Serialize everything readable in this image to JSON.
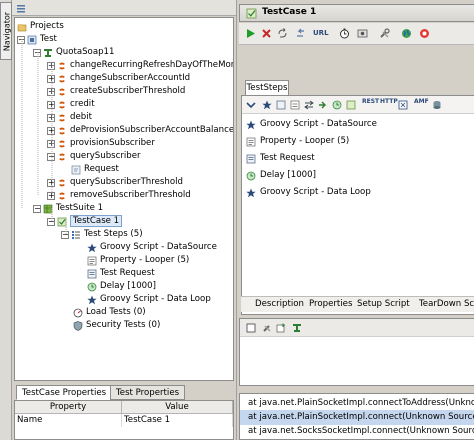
{
  "navigator": {
    "label": "Navigator"
  },
  "tree": {
    "items": [
      {
        "label": "Projects",
        "icon": "projects-folder-icon"
      },
      {
        "label": "Test",
        "icon": "project-icon"
      },
      {
        "label": "QuotaSoap11",
        "icon": "interface-icon"
      },
      {
        "label": "changeRecurringRefreshDayOfTheMonth",
        "icon": "operation-icon"
      },
      {
        "label": "changeSubscriberAccountId",
        "icon": "operation-icon"
      },
      {
        "label": "createSubscriberThreshold",
        "icon": "operation-icon"
      },
      {
        "label": "credit",
        "icon": "operation-icon"
      },
      {
        "label": "debit",
        "icon": "operation-icon"
      },
      {
        "label": "deProvisionSubscriberAccountBalance",
        "icon": "operation-icon"
      },
      {
        "label": "provisionSubscriber",
        "icon": "operation-icon"
      },
      {
        "label": "querySubscriber",
        "icon": "operation-icon"
      },
      {
        "label": "Request",
        "icon": "request-icon"
      },
      {
        "label": "querySubscriberThreshold",
        "icon": "operation-icon"
      },
      {
        "label": "removeSubscriberThreshold",
        "icon": "operation-icon"
      },
      {
        "label": "TestSuite 1",
        "icon": "testsuite-icon"
      },
      {
        "label": "TestCase 1",
        "icon": "testcase-icon"
      },
      {
        "label": "Test Steps (5)",
        "icon": "teststeps-icon"
      },
      {
        "label": "Groovy Script - DataSource",
        "icon": "groovy-star-icon"
      },
      {
        "label": "Property - Looper (5)",
        "icon": "property-icon"
      },
      {
        "label": "Test Request",
        "icon": "test-request-icon"
      },
      {
        "label": "Delay [1000]",
        "icon": "delay-clock-icon"
      },
      {
        "label": "Groovy Script - Data Loop",
        "icon": "groovy-star-icon"
      },
      {
        "label": "Load Tests (0)",
        "icon": "load-test-icon"
      },
      {
        "label": "Security Tests (0)",
        "icon": "security-test-icon"
      }
    ]
  },
  "props": {
    "tabs": [
      "TestCase Properties",
      "Test Properties"
    ],
    "headers": [
      "Property",
      "Value"
    ],
    "rows": [
      {
        "property": "Name",
        "value": "TestCase 1"
      }
    ]
  },
  "testcase": {
    "title": "TestCase 1",
    "toolbar_icons": [
      "run-icon",
      "cancel-icon",
      "loop-icon",
      "back-icon",
      "url-icon",
      "timer-icon",
      "options-icon",
      "tools-icon",
      "globe-icon",
      "help-icon"
    ],
    "url_label": "URL"
  },
  "steps": {
    "tab_label": "TestSteps",
    "toolbar_labels": [
      "REST",
      "HTTP",
      "AMF"
    ],
    "items": [
      {
        "label": "Groovy Script - DataSource",
        "icon": "groovy-star-icon"
      },
      {
        "label": "Property - Looper (5)",
        "icon": "property-icon"
      },
      {
        "label": "Test Request",
        "icon": "test-request-icon"
      },
      {
        "label": "Delay [1000]",
        "icon": "delay-clock-icon"
      },
      {
        "label": "Groovy Script - Data Loop",
        "icon": "groovy-star-icon"
      }
    ]
  },
  "bottom_tabs": [
    "Description",
    "Properties",
    "Setup Script",
    "TearDown Script"
  ],
  "log": {
    "lines": [
      "at java.net.PlainSocketImpl.connectToAddress(Unknown Source)",
      "at java.net.PlainSocketImpl.connect(Unknown Source)",
      "at java.net.SocksSocketImpl.connect(Unknown Source)"
    ]
  },
  "colors": {
    "selection": "#dce9f8",
    "log_selection": "#c5d7ee",
    "run_green": "#1f9d2a",
    "cancel_red": "#c62828"
  }
}
